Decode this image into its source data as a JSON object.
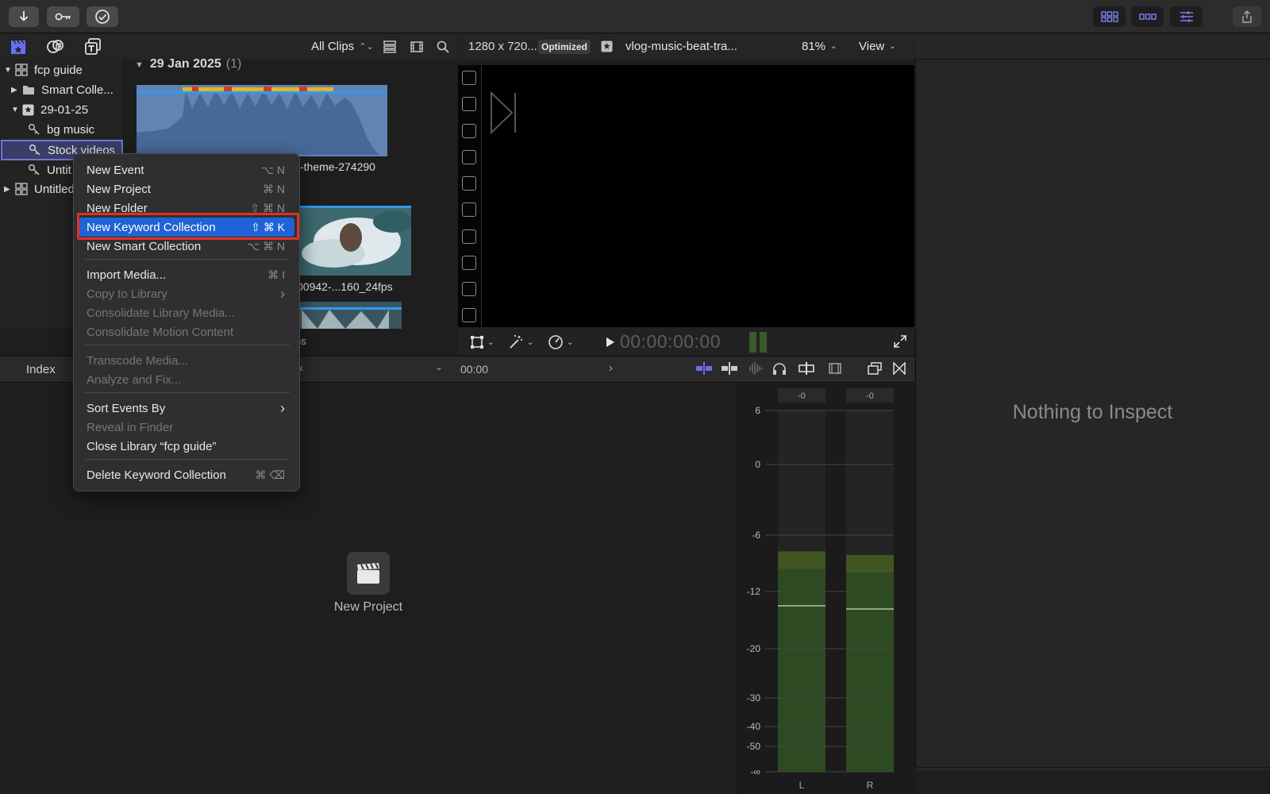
{
  "toolbar": {
    "import_icon": "download-arrow",
    "keyword_icon": "key",
    "check_icon": "checkmark-circle"
  },
  "browser": {
    "filter_label": "All Clips",
    "date_header": "29 Jan 2025",
    "date_count": "(1)"
  },
  "sidebar": {
    "items": [
      {
        "label": "fcp guide"
      },
      {
        "label": "Smart Colle..."
      },
      {
        "label": "29-01-25"
      },
      {
        "label": "bg music"
      },
      {
        "label": "Stock videos"
      },
      {
        "label": "Untit"
      },
      {
        "label": "Untitled"
      }
    ]
  },
  "clips": {
    "clip1_name": "-theme-274290",
    "clip2_name": "00942-...160_24fps",
    "partial_text": "ns"
  },
  "viewer": {
    "resolution": "1280 x 720...",
    "badge": "Optimized",
    "clip_name": "vlog-music-beat-tra...",
    "zoom": "81%",
    "view_label": "View",
    "timecode": "00:00:00:00"
  },
  "timeline": {
    "index_label": "Index",
    "time": "00:00",
    "empty_label": "New Project"
  },
  "inspector": {
    "empty_text": "Nothing to Inspect"
  },
  "meters": {
    "left_peak": "-0",
    "right_peak": "-0",
    "scale": [
      "6",
      "0",
      "-6",
      "-12",
      "-20",
      "-30",
      "-40",
      "-50",
      "-∞"
    ],
    "left_label": "L",
    "right_label": "R",
    "left_level": 0.61,
    "right_level": 0.6
  },
  "context_menu": {
    "items": [
      {
        "label": "New Event",
        "shortcut": "⌥ N",
        "enabled": true
      },
      {
        "label": "New Project",
        "shortcut": "⌘ N",
        "enabled": true
      },
      {
        "label": "New Folder",
        "shortcut": "⇧ ⌘ N",
        "enabled": true
      },
      {
        "label": "New Keyword Collection",
        "shortcut": "⇧ ⌘ K",
        "enabled": true,
        "highlighted": true
      },
      {
        "label": "New Smart Collection",
        "shortcut": "⌥ ⌘ N",
        "enabled": true
      },
      {
        "label": "Import Media...",
        "shortcut": "⌘ I",
        "enabled": true
      },
      {
        "label": "Copy to Library",
        "shortcut": "›",
        "enabled": false
      },
      {
        "label": "Consolidate Library Media...",
        "shortcut": "",
        "enabled": false
      },
      {
        "label": "Consolidate Motion Content",
        "shortcut": "",
        "enabled": false
      },
      {
        "label": "Transcode Media...",
        "shortcut": "",
        "enabled": false
      },
      {
        "label": "Analyze and Fix...",
        "shortcut": "",
        "enabled": false
      },
      {
        "label": "Sort Events By",
        "shortcut": "›",
        "enabled": true
      },
      {
        "label": "Reveal in Finder",
        "shortcut": "",
        "enabled": false
      },
      {
        "label": "Close Library “fcp guide”",
        "shortcut": "",
        "enabled": true
      },
      {
        "label": "Delete Keyword Collection",
        "shortcut": "⌘ ⌫",
        "enabled": true
      }
    ]
  },
  "colors": {
    "highlight": "#1f63d6",
    "annotation_red": "#e03124",
    "meter_green": "#2e4a22",
    "selection": "#3b3d66"
  }
}
